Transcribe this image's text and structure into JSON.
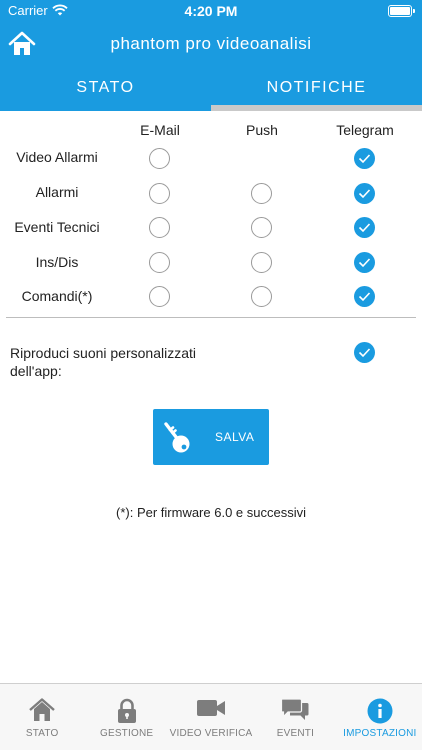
{
  "status_bar": {
    "carrier": "Carrier",
    "time": "4:20 PM"
  },
  "header": {
    "title": "phantom pro videoanalisi",
    "home_icon": "home-icon"
  },
  "tabs": [
    {
      "label": "STATO",
      "active": false
    },
    {
      "label": "NOTIFICHE",
      "active": true
    }
  ],
  "notifications": {
    "columns": [
      "E-Mail",
      "Push",
      "Telegram"
    ],
    "rows": [
      {
        "label": "Video Allarmi",
        "email": false,
        "push": null,
        "telegram": true
      },
      {
        "label": "Allarmi",
        "email": false,
        "push": false,
        "telegram": true
      },
      {
        "label": "Eventi Tecnici",
        "email": false,
        "push": false,
        "telegram": true
      },
      {
        "label": "Ins/Dis",
        "email": false,
        "push": false,
        "telegram": true
      },
      {
        "label": "Comandi(*)",
        "email": false,
        "push": false,
        "telegram": true
      }
    ]
  },
  "custom_sounds": {
    "label": "Riproduci suoni personalizzati dell'app:",
    "checked": true
  },
  "save_button": {
    "label": "SALVA",
    "icon": "key-icon"
  },
  "footnote": "(*): Per firmware 6.0 e successivi",
  "bottom_nav": [
    {
      "label": "STATO",
      "icon": "home-icon",
      "active": false
    },
    {
      "label": "GESTIONE",
      "icon": "lock-icon",
      "active": false
    },
    {
      "label": "VIDEO VERIFICA",
      "icon": "video-camera-icon",
      "active": false
    },
    {
      "label": "EVENTI",
      "icon": "chat-bubbles-icon",
      "active": false
    },
    {
      "label": "IMPOSTAZIONI",
      "icon": "info-icon",
      "active": true
    }
  ],
  "colors": {
    "accent": "#1a9be0",
    "inactive_nav": "#7d7d7d",
    "tab_indicator": "#c9c9c9"
  }
}
